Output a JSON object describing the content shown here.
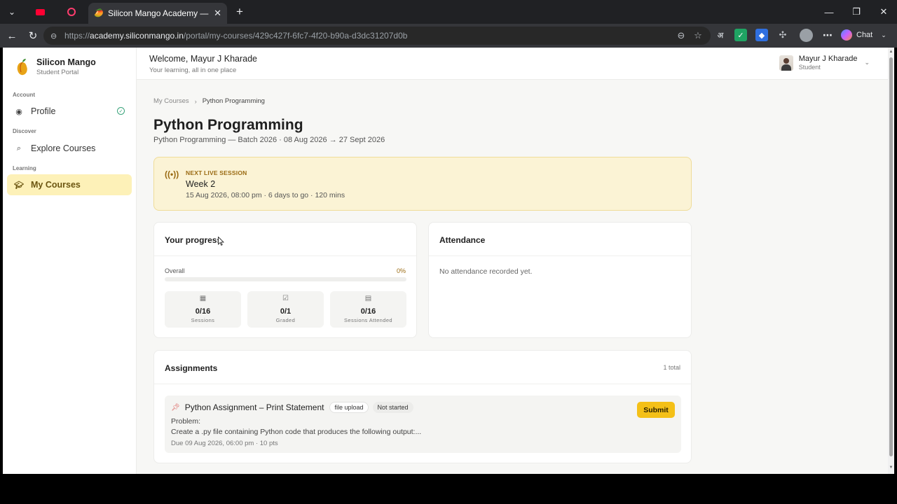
{
  "browser": {
    "active_tab_title": "Silicon Mango Academy — Learn",
    "url_prefix": "https://",
    "url_host": "academy.siliconmango.in",
    "url_path": "/portal/my-courses/429c427f-6fc7-4f20-b90a-d3dc31207d0b",
    "chat_label": "Chat",
    "extension_text": "अ"
  },
  "sidebar": {
    "brand_name": "Silicon Mango",
    "brand_sub": "Student Portal",
    "sections": [
      {
        "label": "Account",
        "item": "Profile"
      },
      {
        "label": "Discover",
        "item": "Explore Courses"
      },
      {
        "label": "Learning",
        "item": "My Courses"
      }
    ]
  },
  "header": {
    "welcome": "Welcome, Mayur J Kharade",
    "tagline": "Your learning, all in one place",
    "user_name": "Mayur J Kharade",
    "user_role": "Student"
  },
  "breadcrumb": {
    "parent": "My Courses",
    "current": "Python Programming"
  },
  "course": {
    "title": "Python Programming",
    "subtitle": "Python Programming — Batch 2026 · 08 Aug 2026 → 27 Sept 2026"
  },
  "live_session": {
    "label": "NEXT LIVE SESSION",
    "title": "Week 2",
    "meta": "15 Aug 2026, 08:00 pm · 6 days to go · 120 mins"
  },
  "progress": {
    "heading": "Your progress",
    "overall_label": "Overall",
    "overall_pct_text": "0%",
    "overall_fraction": 0.0,
    "stats": [
      {
        "value": "0/16",
        "label": "Sessions",
        "icon": "calendar-icon"
      },
      {
        "value": "0/1",
        "label": "Graded",
        "icon": "check-square-icon"
      },
      {
        "value": "0/16",
        "label": "Sessions Attended",
        "icon": "attendance-icon"
      }
    ]
  },
  "attendance": {
    "heading": "Attendance",
    "empty": "No attendance recorded yet."
  },
  "assignments": {
    "heading": "Assignments",
    "total": "1 total",
    "items": [
      {
        "title": "Python Assignment – Print Statement",
        "type_chip": "file upload",
        "status_chip": "Not started",
        "problem_label": "Problem:",
        "description": "Create a .py file containing Python code that produces the following output:...",
        "due": "Due 09 Aug 2026, 06:00 pm · 10 pts",
        "action": "Submit"
      }
    ]
  },
  "colors": {
    "accent": "#f4c018",
    "active_nav_bg": "#fdf1b8",
    "live_banner_bg": "#fbf3d5",
    "check_green": "#3aa37b"
  }
}
